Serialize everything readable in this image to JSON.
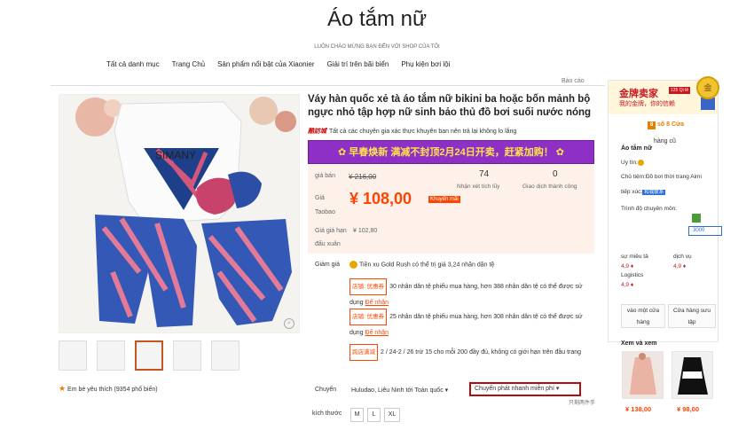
{
  "header": {
    "title": "Áo tắm nữ",
    "subtitle": "LUÔN CHÀO MỪNG BẠN ĐẾN VỚI SHOP CỦA TÔI",
    "nav": [
      "Tất cả danh mục",
      "Trang Chủ",
      "Sản phẩm nổi bật của Xiaonier",
      "Giải trí trên bãi biển",
      "Phụ kiện bơi lội"
    ],
    "report": "Báo cáo"
  },
  "product": {
    "title": "Váy hàn quốc xẻ tà áo tắm nữ bikini ba hoặc bốn mảnh bộ ngực nhỏ tập hợp nữ sinh bảo thủ đồ bơi suối nước nóng",
    "seal_brand": "酷訪城",
    "seal_text": "Tất cả các chuyên gia xác thực khuyên ban nên trả lại không lo lắng",
    "promo_banner": "早春焕新 满减不封顶2月24日开卖，赶紧加购！",
    "price_label": "giá bán",
    "old_price": "¥ 216,00",
    "taobao_price_label_1": "Giá",
    "taobao_price_label_2": "Taobao",
    "price": "¥ 108,00",
    "price_badge": "Khuyến mãi",
    "stats": [
      {
        "value": "74",
        "label": "Nhận xét tích lũy"
      },
      {
        "value": "0",
        "label": "Giao dịch thành công"
      }
    ],
    "limit_label_1": "Giá giá hạn",
    "limit_label_2": "đấu xuân",
    "limit_price": "¥ 102,80",
    "discount_label": "Giảm giá",
    "gold_rush": "Tiền xu Gold Rush có thể trị giá 3,24 nhân dân tệ",
    "coupons": [
      {
        "tag": "店铺: 优惠券",
        "text": "30 nhân dân tệ phiếu mua hàng, hơn 388 nhân dân tệ có thể được sử dụng",
        "link": "Để nhận"
      },
      {
        "tag": "店铺: 优惠券",
        "text": "25 nhân dân tệ phiếu mua hàng, hơn 308 nhân dân tệ có thể được sử dụng",
        "link": "Để nhận"
      },
      {
        "tag": "跨店满减",
        "text": "2 / 24-2 / 26 trừ 15 cho mỗi 200 đầy đủ, không có giới hạn trên đầu trang"
      }
    ],
    "shipping_label": "Chuyển",
    "shipping_from": "Huludao, Liêu Ninh tới Toàn quốc ▾",
    "shipping_method": "Chuyển phát nhanh miễn phí ▾",
    "shipping_cjk": "只剩两件手",
    "size_label": "kích thước",
    "sizes": [
      "M",
      "L",
      "XL"
    ],
    "favorites": "Em bé yêu thích (9354 phổ biến)"
  },
  "seller": {
    "gold_title": "金牌卖家",
    "gold_sub": "我的金牌，你的信赖",
    "rank": "125 Qi lê",
    "medal": "金",
    "store_count": "số 8 Cửa",
    "store_sub": "hàng cũ",
    "name": "Áo tắm nữ",
    "trust": "Uy tín:",
    "shop_line": "Chủ tiệm:Đồ bơi thời trang Aimi",
    "contact": "tiếp xúc:",
    "contact_badge": "和我联系",
    "level": "Trình độ chuyên môn:",
    "level_value": "3000",
    "scores": [
      {
        "label": "sự miêu tả",
        "value": "4,9 ♦"
      },
      {
        "label": "dịch vụ",
        "value": "4,9 ♦"
      },
      {
        "label": "Logistics",
        "value": "4,9 ♦"
      }
    ],
    "btn_visit": "vào một cửa hàng",
    "btn_collect": "Cửa hàng sưu tập",
    "see_more": "Xem và xem",
    "items": [
      {
        "price": "¥ 138,00"
      },
      {
        "price": "¥ 98,00"
      }
    ]
  }
}
